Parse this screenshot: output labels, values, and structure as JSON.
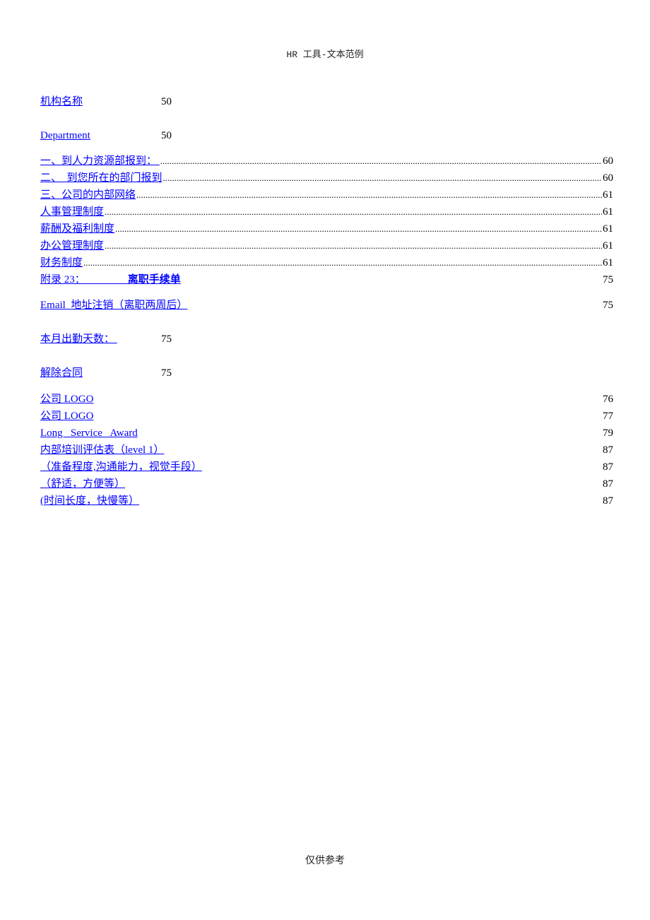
{
  "header": {
    "text": "HR 工具-文本范例"
  },
  "footer": {
    "text": "仅供参考"
  },
  "toc": [
    {
      "label": "机构名称",
      "page": "50",
      "style": "tabbed"
    },
    {
      "label": "Department",
      "page": "50",
      "style": "tabbed"
    },
    {
      "label": "一、到人力资源部报到： ",
      "page": "60",
      "style": "dotted"
    },
    {
      "label": "二、  到您所在的部门报到",
      "page": "60",
      "style": "dotted"
    },
    {
      "label": "三、公司的内部网络",
      "page": "61",
      "style": "dotted"
    },
    {
      "label": "人事管理制度",
      "page": "61",
      "style": "dotted"
    },
    {
      "label": "薪酬及福利制度",
      "page": "61",
      "style": "dotted"
    },
    {
      "label": "办公管理制度",
      "page": "61",
      "style": "dotted"
    },
    {
      "label": "财务制度",
      "page": "61",
      "style": "dotted"
    },
    {
      "label": "附录 23：                离职手续单",
      "page": "75",
      "style": "right",
      "bold_part": "离职手续单"
    },
    {
      "label": "Email  地址注销（离职两周后）",
      "page": "75",
      "style": "right"
    },
    {
      "label": "本月出勤天数： ",
      "page": "75",
      "style": "tabbed"
    },
    {
      "label": "解除合同",
      "page": "75",
      "style": "tabbed"
    },
    {
      "label": "公司 LOGO",
      "page": "76",
      "style": "right"
    },
    {
      "label": "公司 LOGO",
      "page": "77",
      "style": "right"
    },
    {
      "label": "Long   Service   Award",
      "page": "79",
      "style": "right"
    },
    {
      "label": "内部培训评估表（level 1）",
      "page": "87",
      "style": "right"
    },
    {
      "label": "（准备程度,沟通能力，视觉手段）",
      "page": "87",
      "style": "right"
    },
    {
      "label": "（舒适，方便等）",
      "page": "87",
      "style": "right"
    },
    {
      "label": "(时间长度，快慢等）",
      "page": "87",
      "style": "right"
    }
  ]
}
